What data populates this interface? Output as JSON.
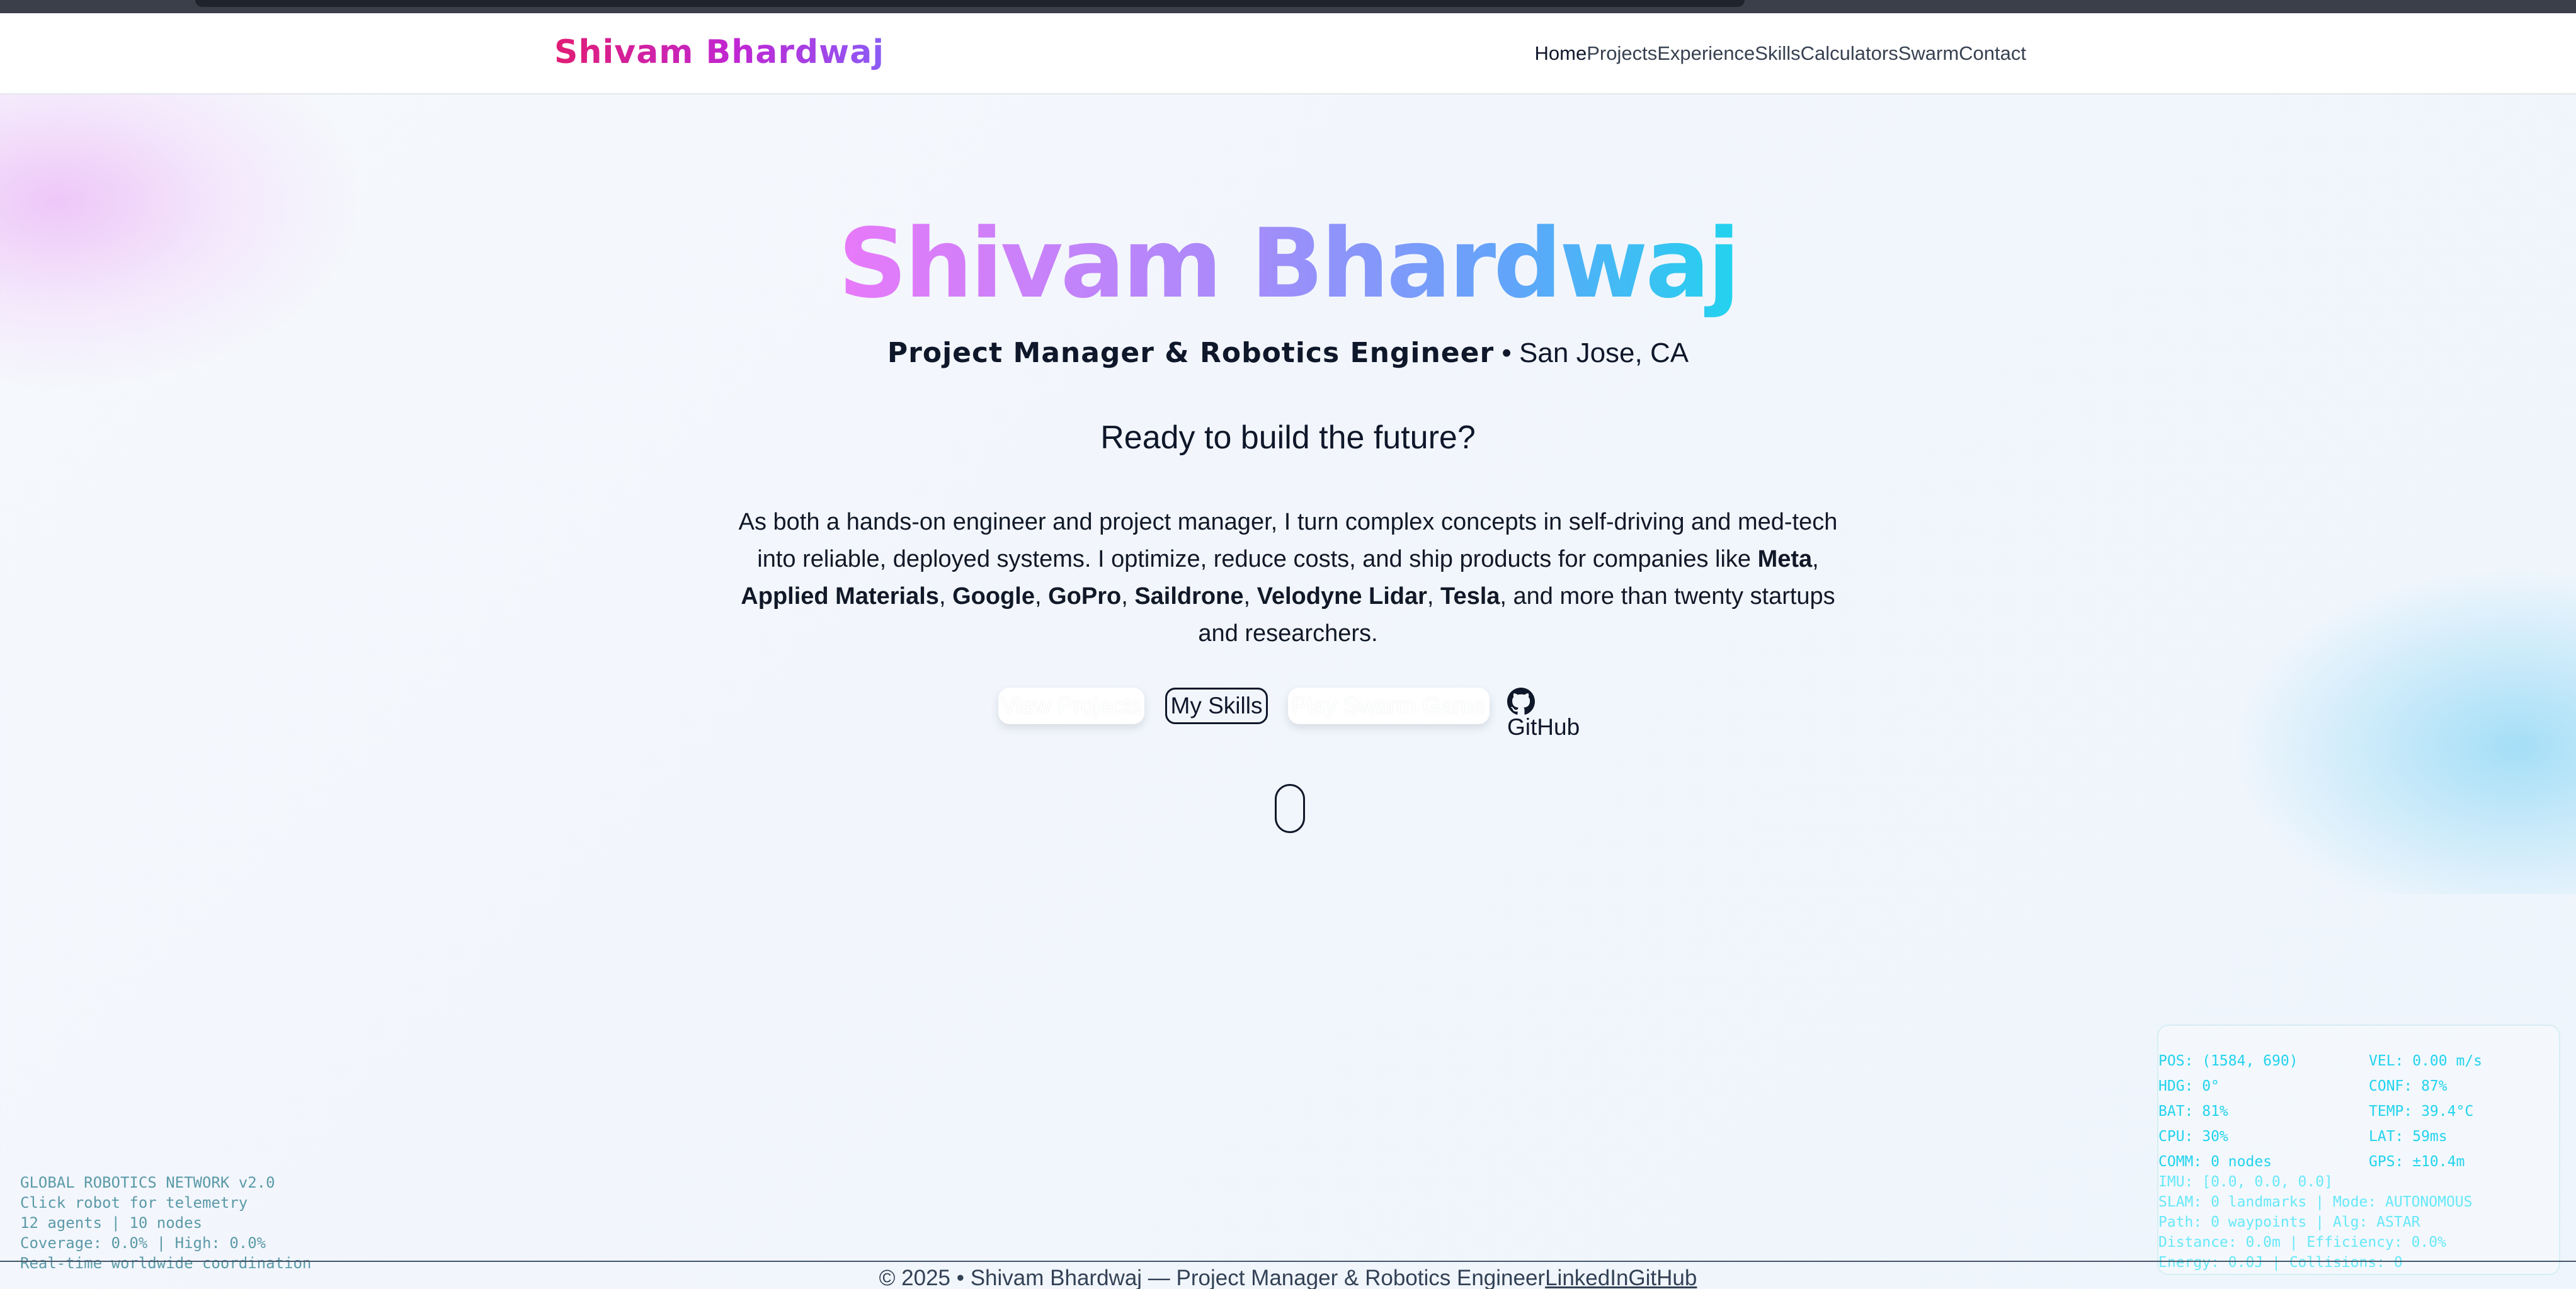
{
  "nav": {
    "brand": "Shivam Bhardwaj",
    "links": [
      "Home",
      "Projects",
      "Experience",
      "Skills",
      "Calculators",
      "Swarm",
      "Contact"
    ]
  },
  "hero": {
    "title": "Shivam Bhardwaj",
    "role": "Project Manager & Robotics Engineer",
    "location": "• San Jose, CA",
    "tagline": "Ready to build the future?",
    "body_intro": "As both a hands-on engineer and project manager, I turn complex concepts in self-driving and med-tech into reliable, deployed systems. I optimize, reduce costs, and ship products for companies like ",
    "companies": [
      "Meta",
      "Applied Materials",
      "Google",
      "GoPro",
      "Saildrone",
      "Velodyne Lidar",
      "Tesla"
    ],
    "body_outro": ", and more than twenty startups and researchers."
  },
  "buttons": {
    "view_projects": "View Projects",
    "my_skills": "My Skills",
    "play_swarm": "Play Swarm Game",
    "github": "GitHub"
  },
  "network_status": {
    "title": "GLOBAL ROBOTICS NETWORK v2.0",
    "hint": "Click robot for telemetry",
    "counts": "12 agents | 10 nodes",
    "coverage": "Coverage: 0.0% | High: 0.0%",
    "tagline": "Real-time worldwide coordination"
  },
  "telemetry": {
    "pos": "POS: (1584, 690)",
    "vel": "VEL: 0.00 m/s",
    "hdg": "HDG: 0°",
    "conf": "CONF: 87%",
    "bat": "BAT: 81%",
    "temp": "TEMP: 39.4°C",
    "cpu": "CPU: 30%",
    "lat": "LAT: 59ms",
    "comm": "COMM: 0 nodes",
    "gps": "GPS: ±10.4m",
    "imu": "IMU: [0.0, 0.0, 0.0]",
    "slam": "SLAM: 0 landmarks | Mode: AUTONOMOUS",
    "path": "Path: 0 waypoints | Alg: ASTAR",
    "distance": "Distance: 0.0m | Efficiency: 0.0%",
    "energy": "Energy: 0.0J | Collisions: 0"
  },
  "footer": {
    "text": "© 2025 • Shivam Bhardwaj — Project Manager & Robotics Engineer",
    "linkedin": "LinkedIn",
    "github": "GitHub"
  },
  "colors": {
    "brand_pink": "#e11d74",
    "hero_gradient_start": "#e879f9",
    "hero_gradient_end": "#22d3ee",
    "telemetry_cyan": "#22d3ee",
    "network_text": "#5b9aa8"
  }
}
